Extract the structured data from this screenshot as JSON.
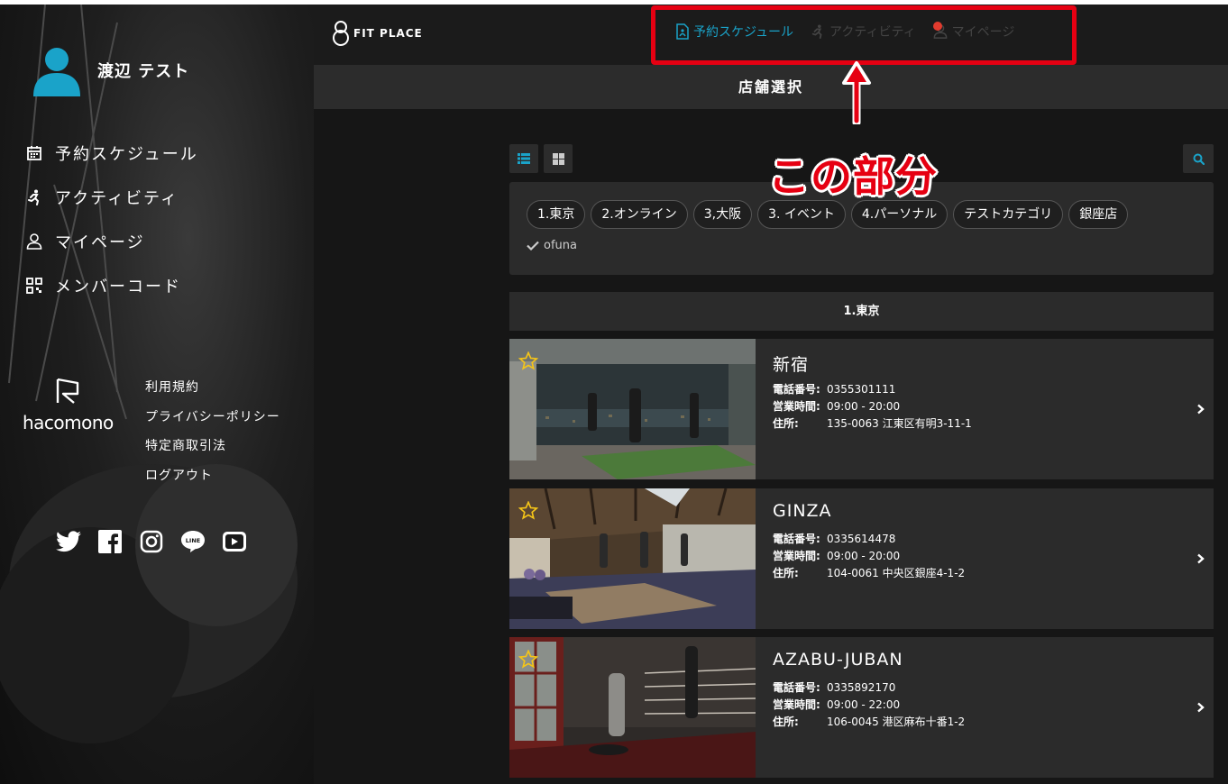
{
  "user": {
    "name": "渡辺 テスト"
  },
  "menu": [
    {
      "label": "予約スケジュール",
      "icon": "calendar-icon"
    },
    {
      "label": "アクティビティ",
      "icon": "running-icon"
    },
    {
      "label": "マイページ",
      "icon": "person-icon"
    },
    {
      "label": "メンバーコード",
      "icon": "qr-code-icon"
    }
  ],
  "footer_brand": {
    "word": "hacomono"
  },
  "legal_links": [
    "利用規約",
    "プライバシーポリシー",
    "特定商取引法",
    "ログアウト"
  ],
  "social": [
    "twitter-icon",
    "facebook-icon",
    "instagram-icon",
    "line-icon",
    "youtube-icon"
  ],
  "header": {
    "brand": "FIT PLACE",
    "tabs": [
      {
        "label": "予約スケジュール",
        "active": true
      },
      {
        "label": "アクティビティ",
        "active": false
      },
      {
        "label": "マイページ",
        "active": false
      }
    ]
  },
  "page_title": "店舗選択",
  "filters": {
    "chips": [
      "1.東京",
      "2.オンライン",
      "3,大阪",
      "3. イベント",
      "4.パーソナル",
      "テストカテゴリ",
      "銀座店"
    ],
    "checked": "ofuna"
  },
  "section_title": "1.東京",
  "labels": {
    "phone": "電話番号:",
    "hours": "営業時間:",
    "address": "住所:"
  },
  "stores": [
    {
      "name": "新宿",
      "phone": "0355301111",
      "hours": "09:00 - 20:00",
      "address": "135-0063 江東区有明3-11-1"
    },
    {
      "name": "GINZA",
      "phone": "0335614478",
      "hours": "09:00 - 20:00",
      "address": "104-0061 中央区銀座4-1-2"
    },
    {
      "name": "AZABU-JUBAN",
      "phone": "0335892170",
      "hours": "09:00 - 22:00",
      "address": "106-0045 港区麻布十番1-2"
    }
  ],
  "annotation": {
    "text": "この部分"
  },
  "colors": {
    "accent": "#1aa3c9",
    "annotation": "#e60012",
    "star": "#f5c518"
  }
}
